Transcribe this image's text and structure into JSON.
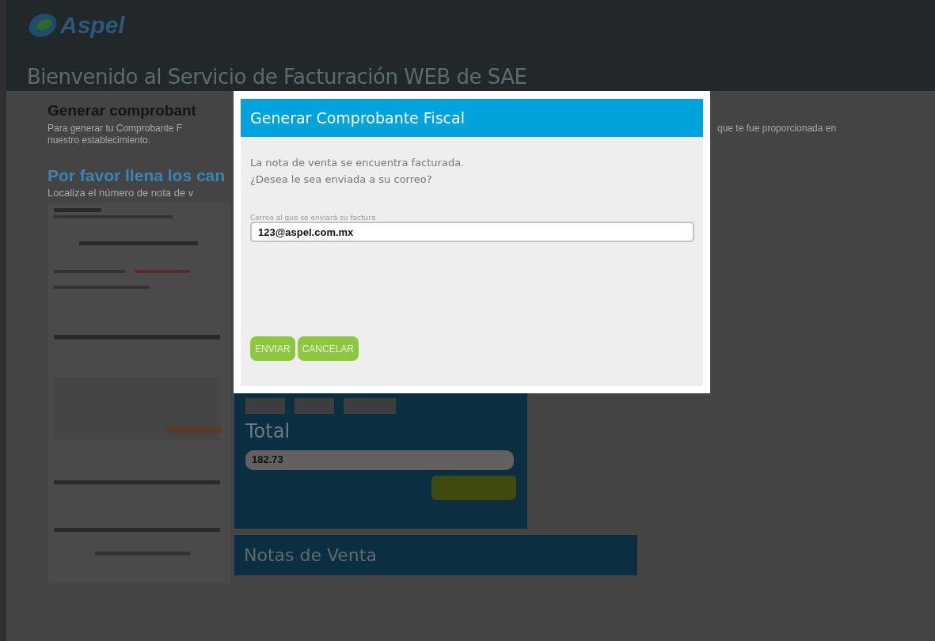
{
  "header": {
    "logo": "Aspel",
    "title": "Bienvenido al Servicio de Facturación WEB de SAE"
  },
  "intro": {
    "heading": "Generar comprobant",
    "text_left": "Para generar tu Comprobante F",
    "text_right": "que te fue proporcionada en",
    "text_line2": "nuestro establecimiento."
  },
  "form": {
    "heading": "Por favor llena los can",
    "hint": "Localiza el número de nota de v"
  },
  "panel": {
    "total_label": "Total",
    "total_value": "182.73"
  },
  "sales_notes": {
    "title": "Notas de Venta"
  },
  "dialog": {
    "title": "Generar Comprobante Fiscal",
    "message": [
      "La nota de venta se encuentra facturada.",
      "¿Desea le sea enviada a su correo?"
    ],
    "email_label": "Correo al que se enviará su factura",
    "email_value": "123@aspel.com.mx",
    "buttons": [
      "ENVIAR",
      "CANCELAR"
    ]
  }
}
